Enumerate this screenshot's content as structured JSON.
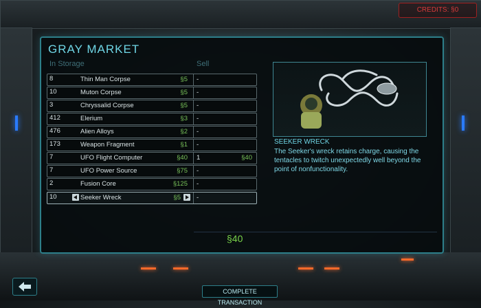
{
  "credits": "CREDITS: §0",
  "title": "GRAY MARKET",
  "columns": {
    "storage": "In Storage",
    "sell": "Sell"
  },
  "items": [
    {
      "qty": "8",
      "name": "Thin Man Corpse",
      "price": "§5",
      "sell": "-",
      "sell_price": ""
    },
    {
      "qty": "10",
      "name": "Muton Corpse",
      "price": "§5",
      "sell": "-",
      "sell_price": ""
    },
    {
      "qty": "3",
      "name": "Chryssalid Corpse",
      "price": "§5",
      "sell": "-",
      "sell_price": ""
    },
    {
      "qty": "412",
      "name": "Elerium",
      "price": "§3",
      "sell": "-",
      "sell_price": ""
    },
    {
      "qty": "476",
      "name": "Alien Alloys",
      "price": "§2",
      "sell": "-",
      "sell_price": ""
    },
    {
      "qty": "173",
      "name": "Weapon Fragment",
      "price": "§1",
      "sell": "-",
      "sell_price": ""
    },
    {
      "qty": "7",
      "name": "UFO Flight Computer",
      "price": "§40",
      "sell": "1",
      "sell_price": "§40"
    },
    {
      "qty": "7",
      "name": "UFO Power Source",
      "price": "§75",
      "sell": "-",
      "sell_price": ""
    },
    {
      "qty": "2",
      "name": "Fusion Core",
      "price": "§125",
      "sell": "-",
      "sell_price": ""
    },
    {
      "qty": "10",
      "name": "Seeker Wreck",
      "price": "§5",
      "sell": "-",
      "sell_price": ""
    }
  ],
  "detail": {
    "title": "SEEKER WRECK",
    "description": "The Seeker's wreck retains charge, causing the tentacles to twitch unexpectedly well beyond the point of nonfunctionality."
  },
  "total": "§40",
  "complete_label": "COMPLETE TRANSACTION",
  "colors": {
    "accent": "#6fd6e6",
    "price": "#79c35a",
    "credits": "#d83a3a"
  }
}
